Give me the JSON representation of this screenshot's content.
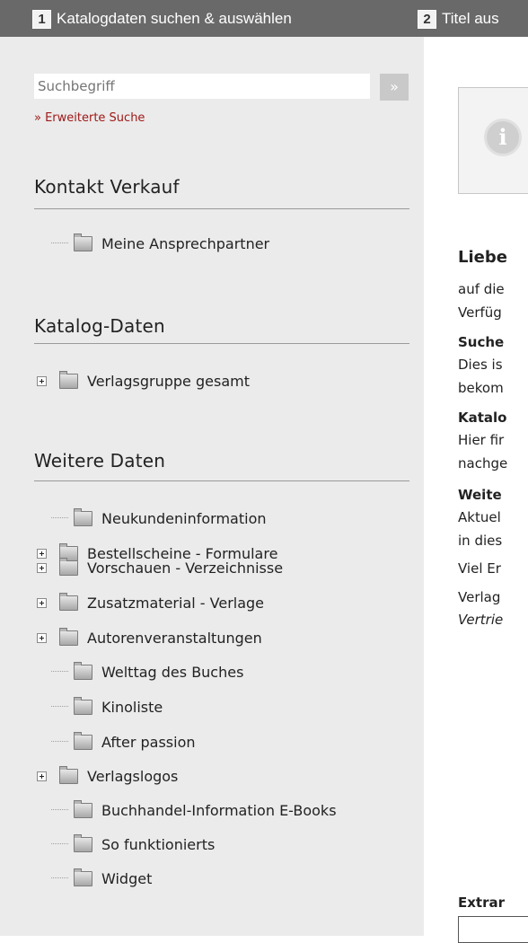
{
  "steps": [
    {
      "num": "1",
      "label": "Katalogdaten suchen & auswählen"
    },
    {
      "num": "2",
      "label": "Titel aus"
    }
  ],
  "search": {
    "placeholder": "Suchbegriff",
    "button": "»",
    "advanced": "» Erweiterte Suche"
  },
  "sections": [
    {
      "title": "Kontakt Verkauf",
      "items": [
        {
          "label": "Meine Ansprechpartner",
          "expandable": false
        }
      ]
    },
    {
      "title": "Katalog-Daten",
      "items": [
        {
          "label": "Verlagsgruppe gesamt",
          "expandable": true
        }
      ]
    },
    {
      "title": "Weitere Daten",
      "items": [
        {
          "label": "Neukundeninformation",
          "expandable": false
        },
        {
          "label": "Bestellscheine - Formulare",
          "expandable": true
        },
        {
          "label": "Vorschauen - Verzeichnisse",
          "expandable": true
        },
        {
          "label": "Zusatzmaterial - Verlage",
          "expandable": true
        },
        {
          "label": "Autorenveranstaltungen",
          "expandable": true
        },
        {
          "label": "Welttag des Buches",
          "expandable": false
        },
        {
          "label": "Kinoliste",
          "expandable": false
        },
        {
          "label": "After passion",
          "expandable": false
        },
        {
          "label": "Verlagslogos",
          "expandable": true
        },
        {
          "label": "Buchhandel-Information E-Books",
          "expandable": false
        },
        {
          "label": "So funktionierts",
          "expandable": false
        },
        {
          "label": "Widget",
          "expandable": false
        }
      ]
    }
  ],
  "main": {
    "heading": "Liebe",
    "p1_line1": "auf die",
    "p1_line2": "Verfüg",
    "s1_title": "Suche",
    "s1_line1": "Dies is",
    "s1_line2": "bekom",
    "s2_title": "Katalo",
    "s2_line1": "Hier fir",
    "s2_line2": "nachge",
    "s3_title": "Weite",
    "s3_line1": "Aktuel",
    "s3_line2": "in dies",
    "p2": "Viel Er",
    "p3_line1": "Verlag",
    "p3_line2": "Vertrie",
    "extranet": "Extrar"
  }
}
